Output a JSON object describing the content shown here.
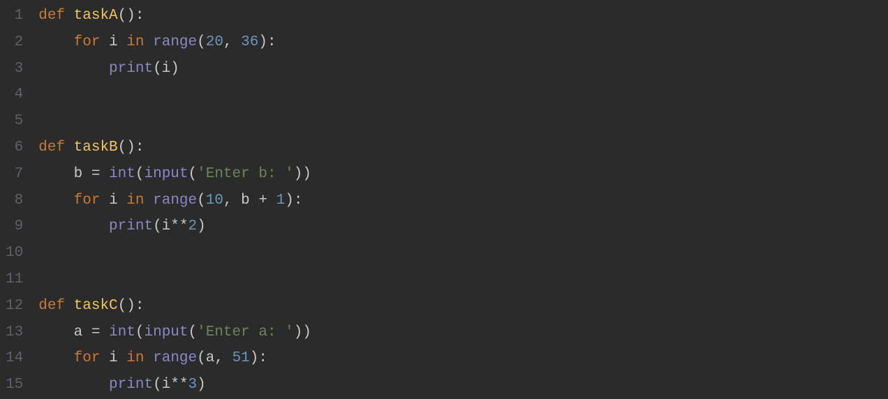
{
  "colors": {
    "background": "#2b2b2b",
    "gutter_text": "#5d6268",
    "default_text": "#c9c9c9",
    "keyword": "#cc7832",
    "function_def": "#f0c75e",
    "builtin": "#8888c6",
    "number": "#6897bb",
    "string": "#6a8759"
  },
  "lines": [
    {
      "n": "1",
      "i": 0,
      "t": [
        {
          "c": "kw",
          "s": "def"
        },
        {
          "c": "p",
          "s": " "
        },
        {
          "c": "fn",
          "s": "taskA"
        },
        {
          "c": "p",
          "s": "():"
        }
      ]
    },
    {
      "n": "2",
      "i": 1,
      "t": [
        {
          "c": "kw",
          "s": "for"
        },
        {
          "c": "p",
          "s": " "
        },
        {
          "c": "id",
          "s": "i"
        },
        {
          "c": "p",
          "s": " "
        },
        {
          "c": "kw",
          "s": "in"
        },
        {
          "c": "p",
          "s": " "
        },
        {
          "c": "bi",
          "s": "range"
        },
        {
          "c": "p",
          "s": "("
        },
        {
          "c": "num",
          "s": "20"
        },
        {
          "c": "p",
          "s": ", "
        },
        {
          "c": "num",
          "s": "36"
        },
        {
          "c": "p",
          "s": "):"
        }
      ]
    },
    {
      "n": "3",
      "i": 2,
      "t": [
        {
          "c": "bi",
          "s": "print"
        },
        {
          "c": "p",
          "s": "("
        },
        {
          "c": "id",
          "s": "i"
        },
        {
          "c": "p",
          "s": ")"
        }
      ]
    },
    {
      "n": "4",
      "i": 0,
      "t": []
    },
    {
      "n": "5",
      "i": 0,
      "t": []
    },
    {
      "n": "6",
      "i": 0,
      "t": [
        {
          "c": "kw",
          "s": "def"
        },
        {
          "c": "p",
          "s": " "
        },
        {
          "c": "fn",
          "s": "taskB"
        },
        {
          "c": "p",
          "s": "():"
        }
      ]
    },
    {
      "n": "7",
      "i": 1,
      "t": [
        {
          "c": "id",
          "s": "b"
        },
        {
          "c": "p",
          "s": " "
        },
        {
          "c": "op",
          "s": "="
        },
        {
          "c": "p",
          "s": " "
        },
        {
          "c": "bi",
          "s": "int"
        },
        {
          "c": "p",
          "s": "("
        },
        {
          "c": "bi",
          "s": "input"
        },
        {
          "c": "p",
          "s": "("
        },
        {
          "c": "str",
          "s": "'Enter b: '"
        },
        {
          "c": "p",
          "s": "))"
        }
      ]
    },
    {
      "n": "8",
      "i": 1,
      "t": [
        {
          "c": "kw",
          "s": "for"
        },
        {
          "c": "p",
          "s": " "
        },
        {
          "c": "id",
          "s": "i"
        },
        {
          "c": "p",
          "s": " "
        },
        {
          "c": "kw",
          "s": "in"
        },
        {
          "c": "p",
          "s": " "
        },
        {
          "c": "bi",
          "s": "range"
        },
        {
          "c": "p",
          "s": "("
        },
        {
          "c": "num",
          "s": "10"
        },
        {
          "c": "p",
          "s": ", "
        },
        {
          "c": "id",
          "s": "b"
        },
        {
          "c": "p",
          "s": " "
        },
        {
          "c": "op",
          "s": "+"
        },
        {
          "c": "p",
          "s": " "
        },
        {
          "c": "num",
          "s": "1"
        },
        {
          "c": "p",
          "s": "):"
        }
      ]
    },
    {
      "n": "9",
      "i": 2,
      "t": [
        {
          "c": "bi",
          "s": "print"
        },
        {
          "c": "p",
          "s": "("
        },
        {
          "c": "id",
          "s": "i"
        },
        {
          "c": "op",
          "s": "**"
        },
        {
          "c": "num",
          "s": "2"
        },
        {
          "c": "p",
          "s": ")"
        }
      ]
    },
    {
      "n": "10",
      "i": 0,
      "t": []
    },
    {
      "n": "11",
      "i": 0,
      "t": []
    },
    {
      "n": "12",
      "i": 0,
      "t": [
        {
          "c": "kw",
          "s": "def"
        },
        {
          "c": "p",
          "s": " "
        },
        {
          "c": "fn",
          "s": "taskC"
        },
        {
          "c": "p",
          "s": "():"
        }
      ]
    },
    {
      "n": "13",
      "i": 1,
      "t": [
        {
          "c": "id",
          "s": "a"
        },
        {
          "c": "p",
          "s": " "
        },
        {
          "c": "op",
          "s": "="
        },
        {
          "c": "p",
          "s": " "
        },
        {
          "c": "bi",
          "s": "int"
        },
        {
          "c": "p",
          "s": "("
        },
        {
          "c": "bi",
          "s": "input"
        },
        {
          "c": "p",
          "s": "("
        },
        {
          "c": "str",
          "s": "'Enter a: '"
        },
        {
          "c": "p",
          "s": "))"
        }
      ]
    },
    {
      "n": "14",
      "i": 1,
      "t": [
        {
          "c": "kw",
          "s": "for"
        },
        {
          "c": "p",
          "s": " "
        },
        {
          "c": "id",
          "s": "i"
        },
        {
          "c": "p",
          "s": " "
        },
        {
          "c": "kw",
          "s": "in"
        },
        {
          "c": "p",
          "s": " "
        },
        {
          "c": "bi",
          "s": "range"
        },
        {
          "c": "p",
          "s": "("
        },
        {
          "c": "id",
          "s": "a"
        },
        {
          "c": "p",
          "s": ", "
        },
        {
          "c": "num",
          "s": "51"
        },
        {
          "c": "p",
          "s": "):"
        }
      ]
    },
    {
      "n": "15",
      "i": 2,
      "t": [
        {
          "c": "bi",
          "s": "print"
        },
        {
          "c": "p",
          "s": "("
        },
        {
          "c": "id",
          "s": "i"
        },
        {
          "c": "op",
          "s": "**"
        },
        {
          "c": "num",
          "s": "3"
        },
        {
          "c": "p",
          "s": ")"
        }
      ]
    }
  ]
}
